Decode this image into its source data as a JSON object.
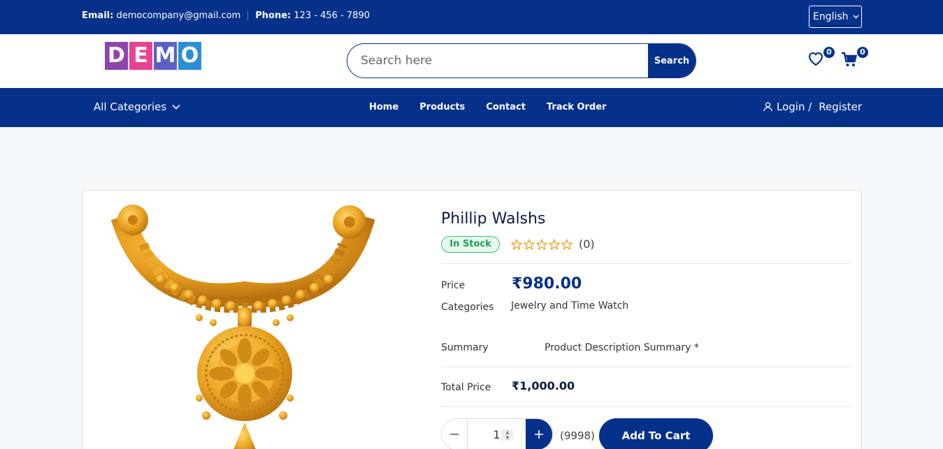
{
  "topbar": {
    "email_label": "Email:",
    "email_value": "democompany@gmail.com",
    "phone_label": "Phone:",
    "phone_value": "123 - 456 - 7890",
    "language": "English"
  },
  "header": {
    "logo_letters": [
      "D",
      "E",
      "M",
      "O"
    ],
    "logo_colors": [
      "#8e44ad",
      "#e84393",
      "#5b5fc7",
      "#2c8fd6"
    ],
    "search_placeholder": "Search here",
    "search_button": "Search",
    "wishlist_count": "0",
    "cart_count": "0"
  },
  "nav": {
    "all_categories": "All Categories",
    "menu": [
      "Home",
      "Products",
      "Contact",
      "Track Order"
    ],
    "login": "Login /",
    "register": "Register"
  },
  "product": {
    "title": "Phillip Walshs",
    "stock": "In Stock",
    "rating_count": "(0)",
    "price_label": "Price",
    "price": "₹980.00",
    "categories_label": "Categories",
    "categories": "Jewelry and Time Watch",
    "summary_label": "Summary",
    "summary": "Product Description Summary *",
    "total_label": "Total Price",
    "total": "₹1,000.00",
    "quantity": "1",
    "available": "(9998)",
    "add_to_cart": "Add To Cart"
  },
  "colors": {
    "brand": "#06318a",
    "stock_green": "#2cc36b",
    "star": "#f0a020",
    "gold": "#e8a020"
  }
}
